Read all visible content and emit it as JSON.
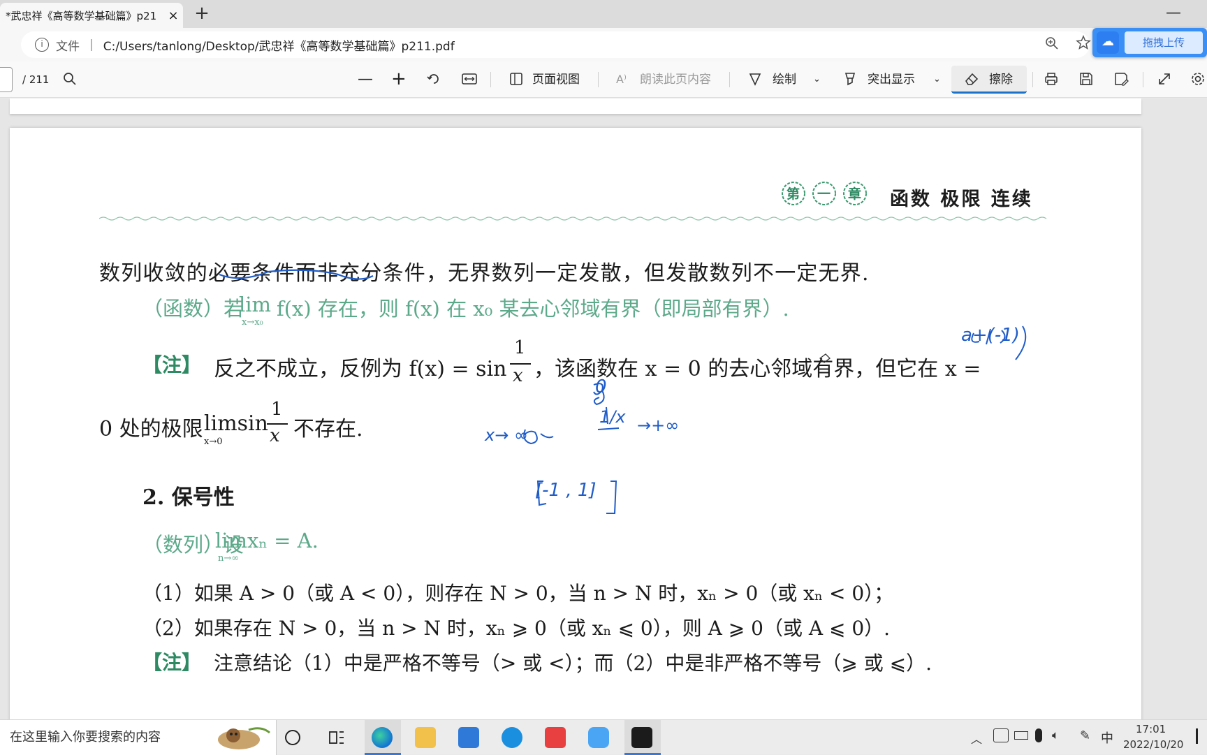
{
  "tab": {
    "title": "*武忠祥《高等数学基础篇》p21",
    "close": "×",
    "new_tab": "+"
  },
  "window": {
    "minimize": "—"
  },
  "address": {
    "info_icon": "i",
    "label": "文件",
    "separator": "|",
    "url": "C:/Users/tanlong/Desktop/武忠祥《高等数学基础篇》p211.pdf"
  },
  "extension": {
    "logo": "☁",
    "button": "拖拽上传"
  },
  "pdf_toolbar": {
    "page_current": "",
    "page_total": "/ 211",
    "zoom_out": "—",
    "zoom_in": "+",
    "page_view": "页面视图",
    "read_aloud": "朗读此页内容",
    "draw": "绘制",
    "highlight": "突出显示",
    "erase": "擦除"
  },
  "document": {
    "chapter_marks": [
      "第",
      "一",
      "章"
    ],
    "chapter_title": "函数 极限 连续",
    "line1": "数列收敛的必要条件而非充分条件，无界数列一定发散，但发散数列不一定无界.",
    "line2_a": "（函数）若",
    "line2_lim": "lim",
    "line2_lim_sub": "x→x₀",
    "line2_b": "f(x) 存在，则 f(x) 在 x₀ 某去心邻域有界（即局部有界）.",
    "note_tag": "【注】",
    "line3_a": "反之不成立，反例为 f(x) = sin",
    "line3_frac_num": "1",
    "line3_frac_den": "x",
    "line3_b": "，该函数在 x = 0 的去心邻域有界，但它在 x =",
    "line4_a": "0 处的极限",
    "line4_lim": "limsin",
    "line4_lim_sub": "x→0",
    "line4_frac_num": "1",
    "line4_frac_den": "x",
    "line4_b": "不存在.",
    "section": "2.  保号性",
    "line5_a": "（数列）设",
    "line5_lim": "limxₙ = A.",
    "line5_lim_sub": "n→∞",
    "line6": "（1）如果 A > 0（或 A < 0），则存在 N > 0，当 n > N 时，xₙ > 0（或 xₙ < 0）；",
    "line7": "（2）如果存在 N > 0，当 n > N 时，xₙ ⩾ 0（或 xₙ ⩽ 0），则 A ⩾ 0（或 A ⩽ 0）.",
    "note2_tag": "【注】",
    "line8": "注意结论（1）中是严格不等号（> 或 <）；而（2）中是非严格不等号（⩾ 或 ⩽）."
  },
  "handwriting": {
    "h1": "a+(-1)",
    "h2": "x→ ∞",
    "h3": "1/x",
    "h4": "→+∞",
    "h5": "[-1 , 1]",
    "h6": "0"
  },
  "taskbar": {
    "search_placeholder": "在这里输入你要搜索的内容",
    "ime": "中",
    "time": "17:01",
    "date": "2022/10/20"
  }
}
